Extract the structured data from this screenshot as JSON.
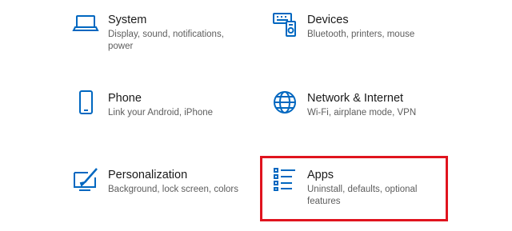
{
  "accent_color": "#0067c0",
  "highlight_color": "#e0141e",
  "tiles": [
    {
      "id": "system",
      "icon": "laptop-icon",
      "title": "System",
      "desc": "Display, sound, notifications, power"
    },
    {
      "id": "devices",
      "icon": "devices-icon",
      "title": "Devices",
      "desc": "Bluetooth, printers, mouse"
    },
    {
      "id": "phone",
      "icon": "phone-icon",
      "title": "Phone",
      "desc": "Link your Android, iPhone"
    },
    {
      "id": "network",
      "icon": "globe-icon",
      "title": "Network & Internet",
      "desc": "Wi-Fi, airplane mode, VPN"
    },
    {
      "id": "personalization",
      "icon": "paint-brush-icon",
      "title": "Personalization",
      "desc": "Background, lock screen, colors"
    },
    {
      "id": "apps",
      "icon": "apps-list-icon",
      "title": "Apps",
      "desc": "Uninstall, defaults, optional features"
    }
  ]
}
